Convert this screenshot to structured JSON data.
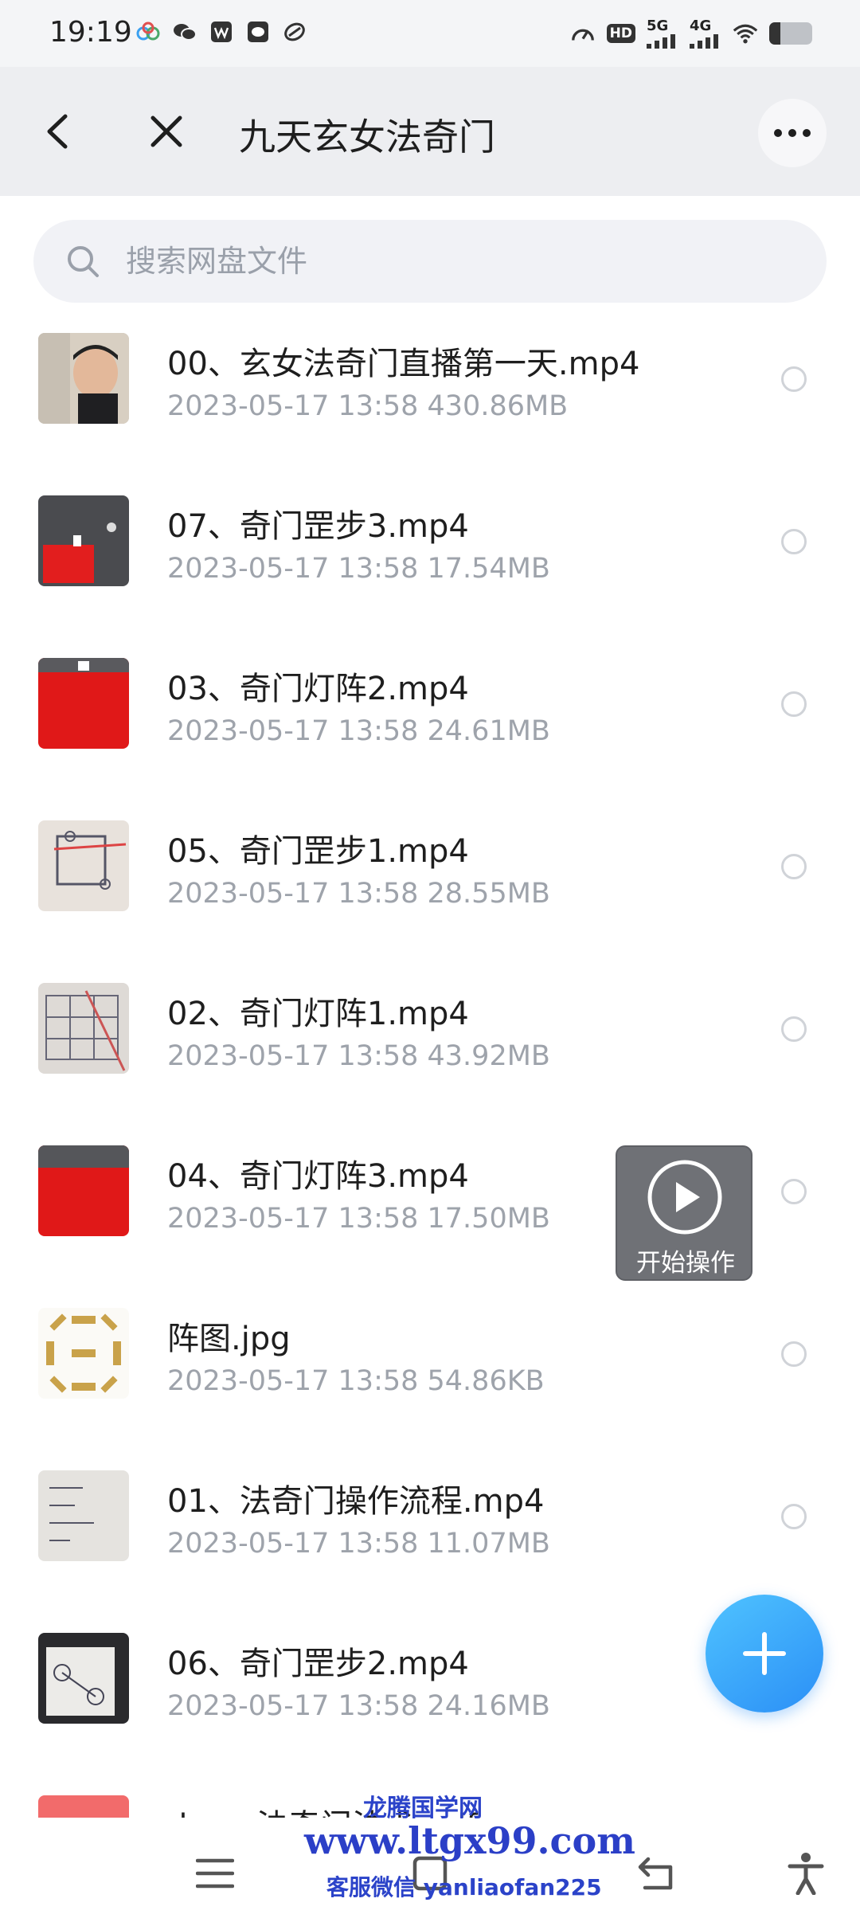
{
  "status_bar": {
    "time": "19:19",
    "left_icons": [
      "app-icon",
      "wechat-icon",
      "wps-icon",
      "wechat-work-icon",
      "link-icon"
    ],
    "hd_label": "HD",
    "net5g": "5G",
    "net4g": "4G",
    "battery_level": 0.25
  },
  "nav": {
    "title": "九天玄女法奇门"
  },
  "search": {
    "placeholder": "搜索网盘文件"
  },
  "files": [
    {
      "name": "00、玄女法奇门直播第一天.mp4",
      "meta": "2023-05-17  13:58  430.86MB",
      "thumb": "person-video"
    },
    {
      "name": "07、奇门罡步3.mp4",
      "meta": "2023-05-17  13:58  17.54MB",
      "thumb": "red-paper-dark"
    },
    {
      "name": "03、奇门灯阵2.mp4",
      "meta": "2023-05-17  13:58  24.61MB",
      "thumb": "red-paper"
    },
    {
      "name": "05、奇门罡步1.mp4",
      "meta": "2023-05-17  13:58  28.55MB",
      "thumb": "diagram-paper"
    },
    {
      "name": "02、奇门灯阵1.mp4",
      "meta": "2023-05-17  13:58  43.92MB",
      "thumb": "grid-paper"
    },
    {
      "name": "04、奇门灯阵3.mp4",
      "meta": "2023-05-17  13:58  17.50MB",
      "thumb": "red-paper"
    },
    {
      "name": "阵图.jpg",
      "meta": "2023-05-17  13:58  54.86KB",
      "thumb": "gold-pattern"
    },
    {
      "name": "01、法奇门操作流程.mp4",
      "meta": "2023-05-17  13:58  11.07MB",
      "thumb": "handwritten-note"
    },
    {
      "name": "06、奇门罡步2.mp4",
      "meta": "2023-05-17  13:58  24.16MB",
      "thumb": "drawing-dark"
    },
    {
      "name": "doc、法奇门法术.pdf",
      "meta": "",
      "thumb": "pdf-icon"
    }
  ],
  "overlay": {
    "label": "开始操作"
  },
  "watermark": {
    "line1": "龙腾国学网",
    "line2": "www.ltgx99.com",
    "line3": "客服微信 yanliaofan225"
  },
  "colors": {
    "accent": "#2b8ff6",
    "nav_bg": "#edeef1",
    "meta_text": "#9ea3ab"
  }
}
